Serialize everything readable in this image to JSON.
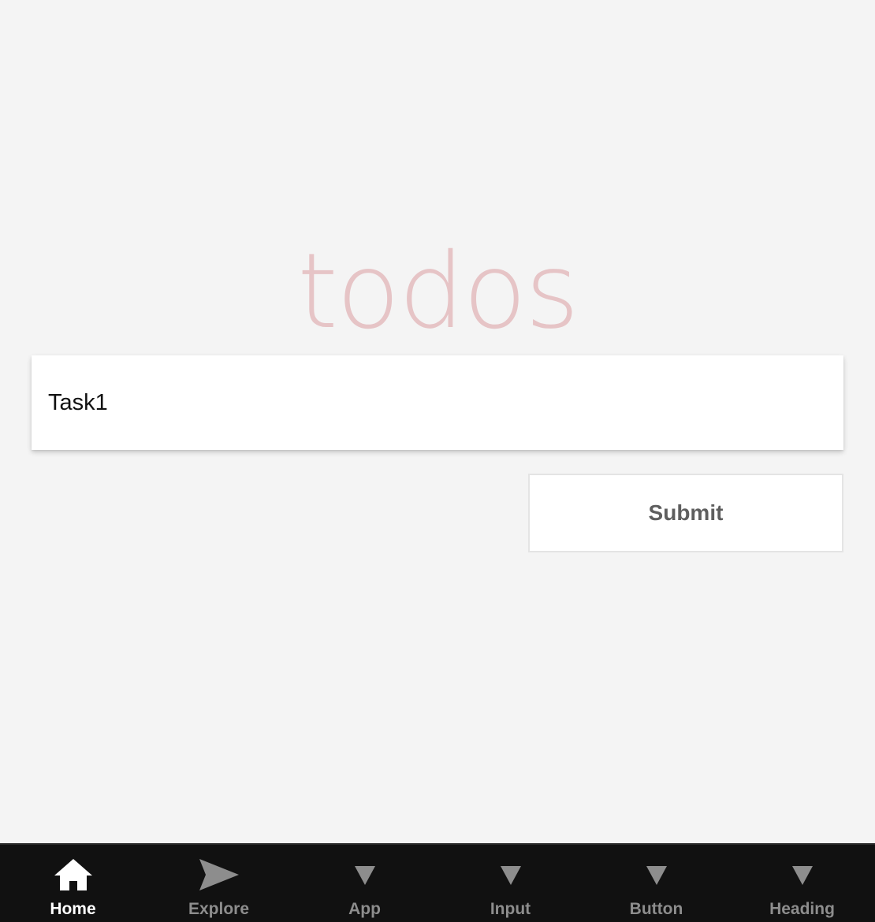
{
  "app": {
    "title": "todos"
  },
  "todo_input": {
    "value": "Task1",
    "placeholder": ""
  },
  "submit_button": {
    "label": "Submit"
  },
  "tabbar": {
    "tabs": [
      {
        "label": "Home",
        "icon": "home-icon",
        "active": true
      },
      {
        "label": "Explore",
        "icon": "send-icon",
        "active": false
      },
      {
        "label": "App",
        "icon": "triangle-down-icon",
        "active": false
      },
      {
        "label": "Input",
        "icon": "triangle-down-icon",
        "active": false
      },
      {
        "label": "Button",
        "icon": "triangle-down-icon",
        "active": false
      },
      {
        "label": "Heading",
        "icon": "triangle-down-icon",
        "active": false
      }
    ]
  },
  "colors": {
    "background": "#f4f4f4",
    "title": "#e6c4c6",
    "tabbar_background": "#111111",
    "tab_active": "#ffffff",
    "tab_inactive": "#8d8d8d"
  }
}
